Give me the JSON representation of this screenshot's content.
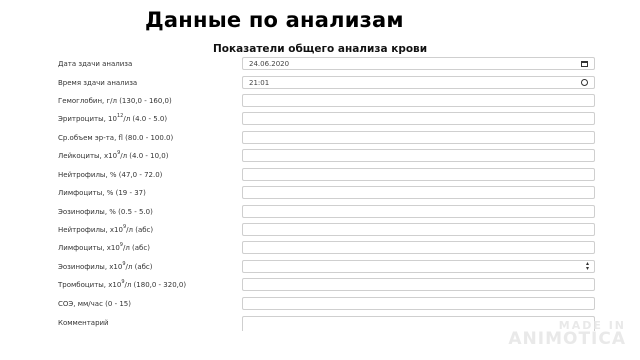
{
  "header": {
    "title": "Данные по анализам",
    "section_title": "Показатели общего анализа крови"
  },
  "form": {
    "rows": [
      {
        "label": "Дата здачи анализа",
        "value": "24.06.2020",
        "icon": "calendar-icon"
      },
      {
        "label": "Время здачи анализа",
        "value": "21:01",
        "icon": "clock-icon"
      },
      {
        "label": "Гемоглобин, г/л (130,0 - 160,0)",
        "value": ""
      },
      {
        "label_pre": "Эритроциты, 10",
        "label_sup": "12",
        "label_post": "/л (4.0 - 5.0)",
        "value": ""
      },
      {
        "label": "Ср.объем эр-та, fl (80.0 - 100.0)",
        "value": ""
      },
      {
        "label_pre": "Лейкоциты, х10",
        "label_sup": "9",
        "label_post": "/л (4.0 - 10,0)",
        "value": ""
      },
      {
        "label": "Нейтрофилы, % (47,0 - 72.0)",
        "value": ""
      },
      {
        "label": "Лимфоциты, % (19 - 37)",
        "value": ""
      },
      {
        "label": "Эозинофилы, % (0.5 - 5.0)",
        "value": ""
      },
      {
        "label_pre": "Нейтрофилы, х10",
        "label_sup": "9",
        "label_post": "/л (абс)",
        "value": ""
      },
      {
        "label_pre": "Лимфоциты, х10",
        "label_sup": "9",
        "label_post": "/л (абс)",
        "value": ""
      },
      {
        "label_pre": "Эозинофилы, х10",
        "label_sup": "9",
        "label_post": "/л (абс)",
        "value": "",
        "icon": "select-arrows-icon"
      },
      {
        "label_pre": "Тромбоциты, х10",
        "label_sup": "9",
        "label_post": "/л (180,0 - 320,0)",
        "value": ""
      },
      {
        "label": "СОЭ, мм/час (0 - 15)",
        "value": ""
      },
      {
        "label": "Комментарий",
        "value": ""
      }
    ]
  },
  "watermark": {
    "line1": "MADE IN",
    "line2": "ANIMOTICA"
  }
}
